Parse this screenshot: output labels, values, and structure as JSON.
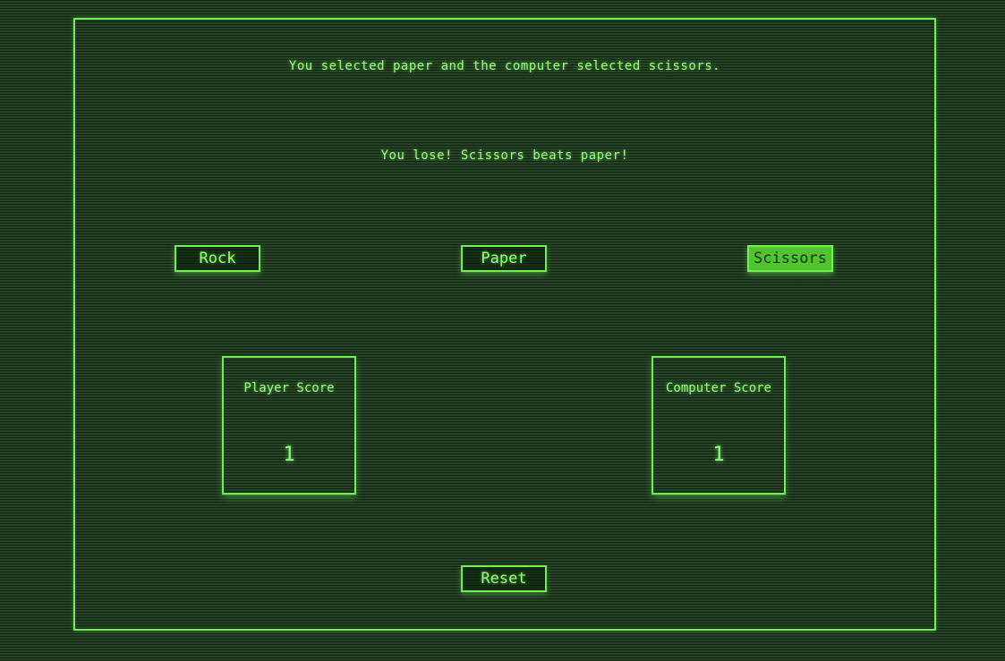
{
  "status": {
    "selection_message": "You selected paper and the computer selected scissors.",
    "result_message": "You lose! Scissors beats paper!"
  },
  "choices": {
    "rock_label": "Rock",
    "paper_label": "Paper",
    "scissors_label": "Scissors",
    "highlighted": "scissors"
  },
  "scores": {
    "player_label": "Player Score",
    "player_value": "1",
    "computer_label": "Computer Score",
    "computer_value": "1"
  },
  "controls": {
    "reset_label": "Reset"
  },
  "colors": {
    "accent": "#6EF04E",
    "text": "#8CFF6E",
    "background": "#203820",
    "active_fill": "#4FC42F"
  }
}
